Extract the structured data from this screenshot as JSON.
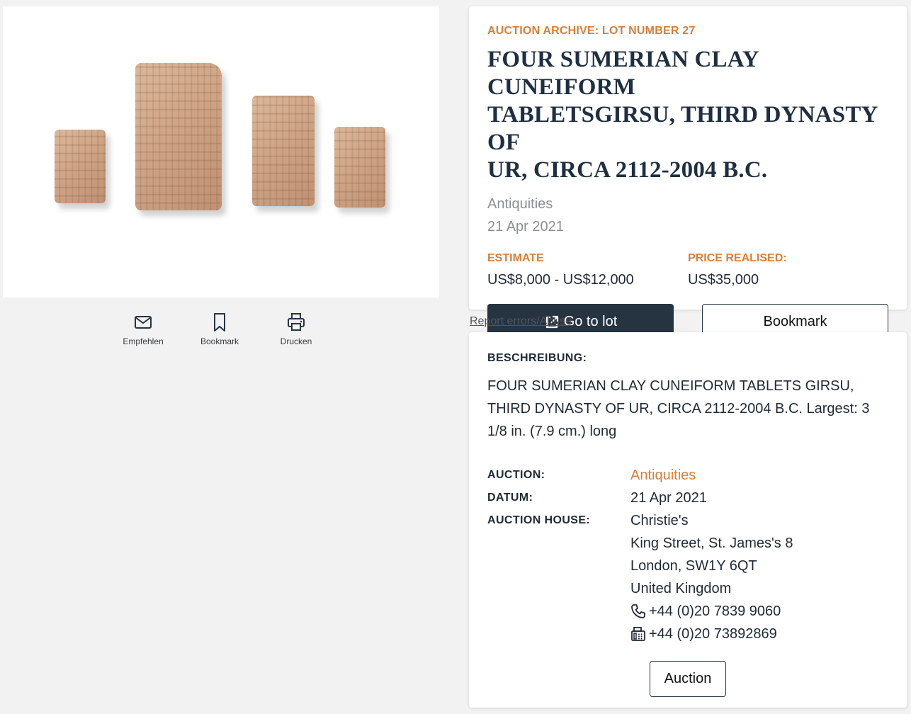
{
  "actions": {
    "recommend": "Empfehlen",
    "bookmark": "Bookmark",
    "print": "Drucken"
  },
  "lot": {
    "eyebrow": "AUCTION ARCHIVE: LOT NUMBER 27",
    "title_lines": [
      "FOUR SUMERIAN CLAY CUNEIFORM",
      "TABLETSGIRSU, THIRD DYNASTY OF",
      "UR, CIRCA 2112-2004 B.C."
    ],
    "sale": "Antiquities",
    "date": "21 Apr 2021",
    "estimate_label": "ESTIMATE",
    "estimate_value": "US$8,000 - US$12,000",
    "realised_label": "PRICE REALISED:",
    "realised_value": "US$35,000",
    "go_button": "Go to lot",
    "bookmark_button": "Bookmark"
  },
  "report_link": "Report errors/Abuse",
  "description": {
    "label": "BESCHREIBUNG:",
    "text": "FOUR SUMERIAN CLAY CUNEIFORM TABLETS GIRSU, THIRD DYNASTY OF UR, CIRCA 2112-2004 B.C. Largest: 3 1/8 in. (7.9 cm.) long"
  },
  "details": {
    "auction_label": "AUCTION:",
    "auction_value": "Antiquities",
    "date_label": "DATUM:",
    "date_value": "21 Apr 2021",
    "house_label": "AUCTION HOUSE:",
    "house_name": "Christie's",
    "street": "King Street, St. James's 8",
    "city": "London, SW1Y 6QT",
    "country": "United Kingdom",
    "phone": "+44 (0)20 7839 9060",
    "fax": "+44 (0)20 73892869",
    "auction_button": "Auction"
  },
  "colors": {
    "accent": "#d97f3a",
    "navy": "#263442",
    "background": "#f2f2f2"
  }
}
